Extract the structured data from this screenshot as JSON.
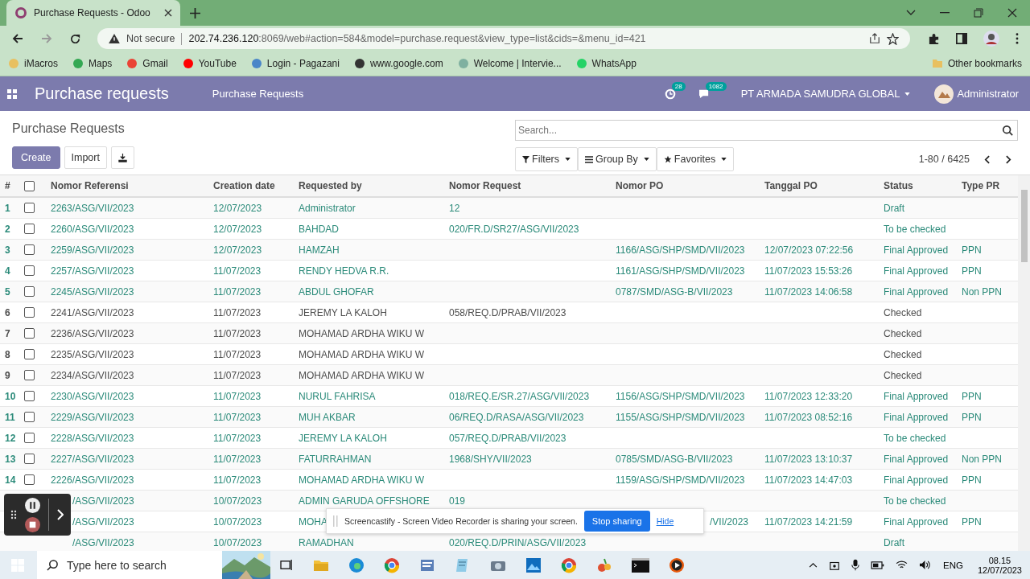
{
  "browser": {
    "tab_title": "Purchase Requests - Odoo",
    "security": "Not secure",
    "url_host": "202.74.236.120",
    "url_rest": ":8069/web#action=584&model=purchase.request&view_type=list&cids=&menu_id=421",
    "bookmarks": [
      "iMacros",
      "Maps",
      "Gmail",
      "YouTube",
      "Login - Pagazani",
      "www.google.com",
      "Welcome | Intervie...",
      "WhatsApp"
    ],
    "other_bookmarks": "Other bookmarks"
  },
  "navbar": {
    "app_title": "Purchase requests",
    "menu": "Purchase Requests",
    "activity_count": "28",
    "message_count": "1082",
    "company": "PT ARMADA SAMUDRA GLOBAL",
    "user": "Administrator"
  },
  "control_panel": {
    "breadcrumb": "Purchase Requests",
    "search_placeholder": "Search...",
    "create": "Create",
    "import": "Import",
    "filters": "Filters",
    "group_by": "Group By",
    "favorites": "Favorites",
    "pager": "1-80 / 6425"
  },
  "table": {
    "select_all": {
      "checked": false
    },
    "columns": [
      "#",
      "Nomor Referensi",
      "Creation date",
      "Requested by",
      "Nomor Request",
      "Nomor PO",
      "Tanggal PO",
      "Status",
      "Type PR"
    ],
    "rows": [
      {
        "number": "1",
        "checked": false,
        "color": "#2a8a79",
        "ref": "2263/ASG/VII/2023",
        "date": "12/07/2023",
        "requested_by": "Administrator",
        "request_no": "12",
        "po_no": "",
        "po_date": "",
        "status": "Draft",
        "type": ""
      },
      {
        "number": "2",
        "checked": false,
        "color": "#2a8a79",
        "ref": "2260/ASG/VII/2023",
        "date": "12/07/2023",
        "requested_by": "BAHDAD",
        "request_no": "020/FR.D/SR27/ASG/VII/2023",
        "po_no": "",
        "po_date": "",
        "status": "To be checked",
        "type": ""
      },
      {
        "number": "3",
        "checked": false,
        "color": "#2a8a79",
        "ref": "2259/ASG/VII/2023",
        "date": "12/07/2023",
        "requested_by": "HAMZAH",
        "request_no": "",
        "po_no": "1166/ASG/SHP/SMD/VII/2023",
        "po_date": "12/07/2023 07:22:56",
        "status": "Final Approved",
        "type": "PPN"
      },
      {
        "number": "4",
        "checked": false,
        "color": "#2a8a79",
        "ref": "2257/ASG/VII/2023",
        "date": "11/07/2023",
        "requested_by": "RENDY HEDVA R.R.",
        "request_no": "",
        "po_no": "1161/ASG/SHP/SMD/VII/2023",
        "po_date": "11/07/2023 15:53:26",
        "status": "Final Approved",
        "type": "PPN"
      },
      {
        "number": "5",
        "checked": false,
        "color": "#2a8a79",
        "ref": "2245/ASG/VII/2023",
        "date": "11/07/2023",
        "requested_by": "ABDUL GHOFAR",
        "request_no": "",
        "po_no": "0787/SMD/ASG-B/VII/2023",
        "po_date": "11/07/2023 14:06:58",
        "status": "Final Approved",
        "type": "Non PPN"
      },
      {
        "number": "6",
        "checked": false,
        "color": "#4d4d4d",
        "ref": "2241/ASG/VII/2023",
        "date": "11/07/2023",
        "requested_by": "JEREMY LA KALOH",
        "request_no": "058/REQ.D/PRAB/VII/2023",
        "po_no": "",
        "po_date": "",
        "status": "Checked",
        "type": ""
      },
      {
        "number": "7",
        "checked": false,
        "color": "#4d4d4d",
        "ref": "2236/ASG/VII/2023",
        "date": "11/07/2023",
        "requested_by": "MOHAMAD ARDHA WIKU W",
        "request_no": "",
        "po_no": "",
        "po_date": "",
        "status": "Checked",
        "type": ""
      },
      {
        "number": "8",
        "checked": false,
        "color": "#4d4d4d",
        "ref": "2235/ASG/VII/2023",
        "date": "11/07/2023",
        "requested_by": "MOHAMAD ARDHA WIKU W",
        "request_no": "",
        "po_no": "",
        "po_date": "",
        "status": "Checked",
        "type": ""
      },
      {
        "number": "9",
        "checked": false,
        "color": "#4d4d4d",
        "ref": "2234/ASG/VII/2023",
        "date": "11/07/2023",
        "requested_by": "MOHAMAD ARDHA WIKU W",
        "request_no": "",
        "po_no": "",
        "po_date": "",
        "status": "Checked",
        "type": ""
      },
      {
        "number": "10",
        "checked": false,
        "color": "#2a8a79",
        "ref": "2230/ASG/VII/2023",
        "date": "11/07/2023",
        "requested_by": "NURUL FAHRISA",
        "request_no": "018/REQ.E/SR.27/ASG/VII/2023",
        "po_no": "1156/ASG/SHP/SMD/VII/2023",
        "po_date": "11/07/2023 12:33:20",
        "status": "Final Approved",
        "type": "PPN"
      },
      {
        "number": "11",
        "checked": false,
        "color": "#2a8a79",
        "ref": "2229/ASG/VII/2023",
        "date": "11/07/2023",
        "requested_by": "MUH AKBAR",
        "request_no": "06/REQ.D/RASA/ASG/VII/2023",
        "po_no": "1155/ASG/SHP/SMD/VII/2023",
        "po_date": "11/07/2023 08:52:16",
        "status": "Final Approved",
        "type": "PPN"
      },
      {
        "number": "12",
        "checked": false,
        "color": "#2a8a79",
        "ref": "2228/ASG/VII/2023",
        "date": "11/07/2023",
        "requested_by": "JEREMY LA KALOH",
        "request_no": "057/REQ.D/PRAB/VII/2023",
        "po_no": "",
        "po_date": "",
        "status": "To be checked",
        "type": ""
      },
      {
        "number": "13",
        "checked": false,
        "color": "#2a8a79",
        "ref": "2227/ASG/VII/2023",
        "date": "11/07/2023",
        "requested_by": "FATURRAHMAN",
        "request_no": "1968/SHY/VII/2023",
        "po_no": "0785/SMD/ASG-B/VII/2023",
        "po_date": "11/07/2023 13:10:37",
        "status": "Final Approved",
        "type": "Non PPN"
      },
      {
        "number": "14",
        "checked": false,
        "color": "#2a8a79",
        "ref": "2226/ASG/VII/2023",
        "date": "11/07/2023",
        "requested_by": "MOHAMAD ARDHA WIKU W",
        "request_no": "",
        "po_no": "1159/ASG/SHP/SMD/VII/2023",
        "po_date": "11/07/2023 14:47:03",
        "status": "Final Approved",
        "type": "PPN"
      },
      {
        "color": "#2a8a79",
        "ref": "/ASG/VII/2023",
        "date": "10/07/2023",
        "requested_by": "ADMIN GARUDA OFFSHORE",
        "request_no": "019",
        "po_no": "",
        "po_date": "",
        "status": "To be checked",
        "type": ""
      },
      {
        "color": "#2a8a79",
        "ref": "/ASG/VII/2023",
        "date": "10/07/2023",
        "requested_by": "MOHA",
        "request_no": "",
        "po_no": "/VII/2023",
        "po_date": "11/07/2023 14:21:59",
        "status": "Final Approved",
        "type": "PPN"
      },
      {
        "color": "#2a8a79",
        "ref": "/ASG/VII/2023",
        "date": "10/07/2023",
        "requested_by": "RAMADHAN",
        "request_no": "020/REQ.D/PRIN/ASG/VII/2023",
        "po_no": "",
        "po_date": "",
        "status": "Draft",
        "type": ""
      }
    ]
  },
  "share_banner": {
    "message": "Screencastify - Screen Video Recorder is sharing your screen.",
    "stop": "Stop sharing",
    "hide": "Hide"
  },
  "taskbar": {
    "search_placeholder": "Type here to search",
    "language": "ENG",
    "time": "08.15",
    "date": "12/07/2023"
  }
}
